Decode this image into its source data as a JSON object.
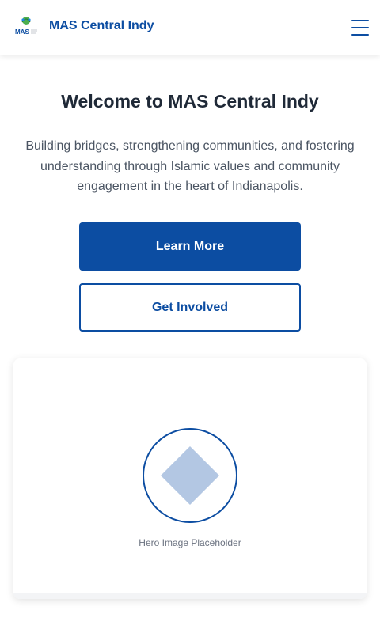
{
  "header": {
    "brand_name": "MAS Central Indy",
    "logo_text": "MAS",
    "menu_icon": "hamburger-menu-icon"
  },
  "hero": {
    "title": "Welcome to MAS Central Indy",
    "subtitle": "Building bridges, strengthening communities, and fostering understanding through Islamic values and community engagement in the heart of Indianapolis.",
    "primary_button": "Learn More",
    "secondary_button": "Get Involved"
  },
  "hero_image": {
    "label": "Hero Image Placeholder",
    "icon": "diamond-placeholder-icon"
  },
  "colors": {
    "accent": "#0c4da2",
    "placeholder_fill": "#b3c7e3",
    "text_dark": "#1f2937",
    "text_muted": "#4b5563"
  }
}
